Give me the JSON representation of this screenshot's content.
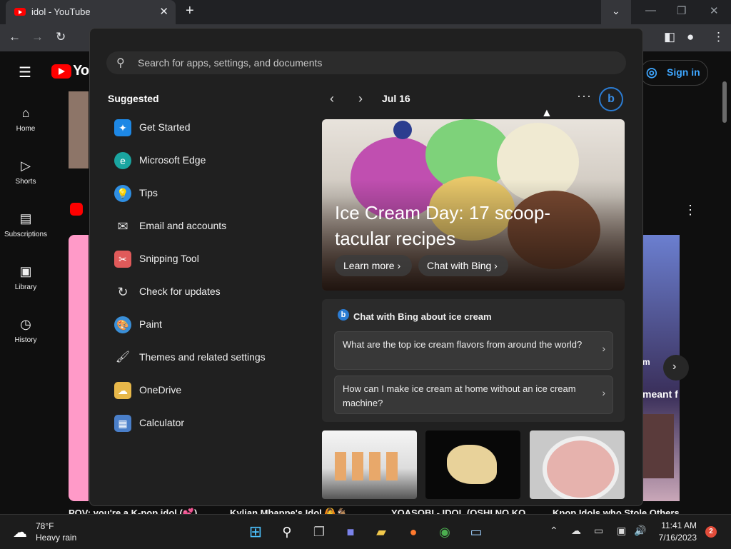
{
  "browser": {
    "tab_title": "idol - YouTube",
    "tab_close": "✕",
    "new_tab": "+",
    "back": "←",
    "forward": "→",
    "reload": "↻",
    "menu": "⋮"
  },
  "youtube": {
    "logo_text": "YouTube",
    "sign_in": "Sign in",
    "sidebar": [
      {
        "label": "Home",
        "icon": "home-icon"
      },
      {
        "label": "Shorts",
        "icon": "shorts-icon"
      },
      {
        "label": "Subscriptions",
        "icon": "subscriptions-icon"
      },
      {
        "label": "Library",
        "icon": "library-icon"
      },
      {
        "label": "History",
        "icon": "history-icon"
      }
    ],
    "video_titles": [
      "POV: you're a K-pop idol (💕)",
      "Kylian Mbappe's Idol 🙆🐐",
      "YOASOBI - IDOL (OSHI NO KO",
      "Kpop Idols who Stole Others"
    ],
    "fragment_text_1": "m",
    "fragment_text_2": "meant f"
  },
  "start_menu": {
    "search_placeholder": "Search for apps, settings, and documents",
    "suggested_heading": "Suggested",
    "suggested": [
      {
        "label": "Get Started",
        "icon": "get-started-icon",
        "color": "#1e88e5"
      },
      {
        "label": "Microsoft Edge",
        "icon": "edge-icon",
        "color": "#1aa5a0"
      },
      {
        "label": "Tips",
        "icon": "tips-icon",
        "color": "#2f8fe3"
      },
      {
        "label": "Email and accounts",
        "icon": "mail-icon",
        "color": "#202020"
      },
      {
        "label": "Snipping Tool",
        "icon": "snipping-tool-icon",
        "color": "#e05a5a"
      },
      {
        "label": "Check for updates",
        "icon": "update-icon",
        "color": "#202020"
      },
      {
        "label": "Paint",
        "icon": "paint-icon",
        "color": "#3a8fd8"
      },
      {
        "label": "Themes and related settings",
        "icon": "brush-icon",
        "color": "#202020"
      },
      {
        "label": "OneDrive",
        "icon": "onedrive-icon",
        "color": "#e8b84a"
      },
      {
        "label": "Calculator",
        "icon": "calculator-icon",
        "color": "#4a7fc9"
      }
    ],
    "feed_date": "Jul 16",
    "more": "···",
    "bing_badge": "b",
    "hero_title": "Ice Cream Day: 17 scoop-tacular recipes",
    "learn_more": "Learn more ›",
    "chat_with_bing": "Chat with Bing ›",
    "chat_heading": "Chat with Bing about ice cream",
    "questions": [
      "What are the top ice cream flavors from around the world?",
      "How can I make ice cream at home without an ice cream machine?"
    ]
  },
  "taskbar": {
    "temperature": "78°F",
    "condition": "Heavy rain",
    "time": "11:41 AM",
    "date": "7/16/2023",
    "notifications": "2"
  }
}
